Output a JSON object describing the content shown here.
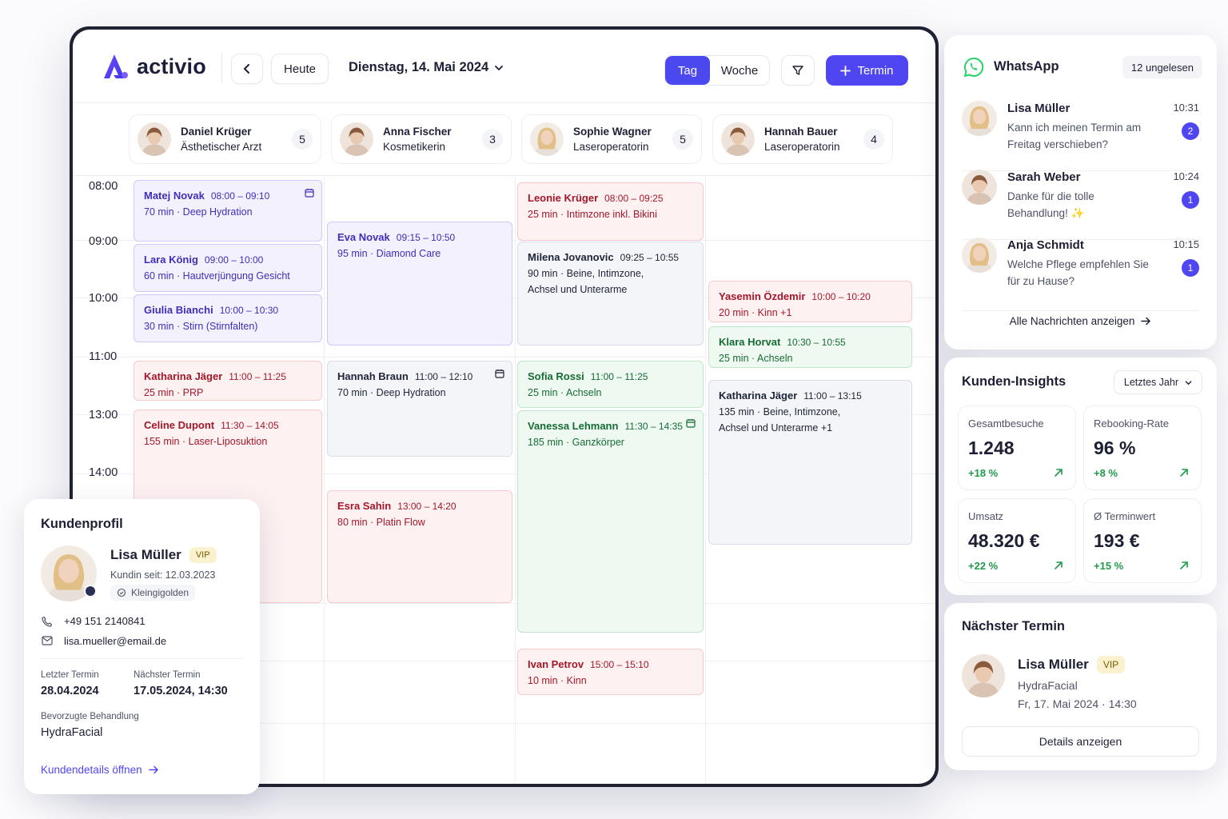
{
  "app": {
    "brand": "activio"
  },
  "toolbar": {
    "today": "Heute",
    "date": "Dienstag, 14. Mai 2024",
    "view_day": "Tag",
    "view_week": "Woche",
    "new_appointment": "Termin"
  },
  "staff": [
    {
      "name": "Daniel Krüger",
      "role": "Ästhetischer Arzt",
      "count": "5"
    },
    {
      "name": "Anna Fischer",
      "role": "Kosmetikerin",
      "count": "3"
    },
    {
      "name": "Sophie Wagner",
      "role": "Laseroperatorin",
      "count": "5"
    },
    {
      "name": "Hannah Bauer",
      "role": "Laseroperatorin",
      "count": "4"
    }
  ],
  "times": [
    "08:00",
    "09:00",
    "10:00",
    "11:00",
    "13:00",
    "14:00"
  ],
  "events": [
    {
      "name": "Matej Novak",
      "time": "08:00 – 09:10",
      "dur": "70 min",
      "treat": "Deep Hydration"
    },
    {
      "name": "Lara König",
      "time": "09:00 – 10:00",
      "dur": "60 min",
      "treat": "Hautverjüngung Gesicht"
    },
    {
      "name": "Giulia Bianchi",
      "time": "10:00 – 10:30",
      "dur": "30 min",
      "treat": "Stirn (Stirnfalten)"
    },
    {
      "name": "Katharina Jäger",
      "time": "11:00 – 11:25",
      "dur": "25 min",
      "treat": "PRP"
    },
    {
      "name": "Celine Dupont",
      "time": "11:30 – 14:05",
      "dur": "155 min",
      "treat": "Laser-Liposuktion"
    },
    {
      "name": "Eva Novak",
      "time": "09:15 – 10:50",
      "dur": "95 min",
      "treat": "Diamond Care"
    },
    {
      "name": "Hannah Braun",
      "time": "11:00 – 12:10",
      "dur": "70 min",
      "treat": "Deep Hydration"
    },
    {
      "name": "Esra Sahin",
      "time": "13:00 – 14:20",
      "dur": "80 min",
      "treat": "Platin Flow"
    },
    {
      "name": "Leonie Krüger",
      "time": "08:00 – 09:25",
      "dur": "25 min",
      "treat": "Intimzone inkl. Bikini"
    },
    {
      "name": "Milena Jovanovic",
      "time": "09:25 – 10:55",
      "dur": "90 min",
      "treat": "Beine, Intimzone,",
      "treat2": "Achsel und Unterarme"
    },
    {
      "name": "Sofia Rossi",
      "time": "11:00 – 11:25",
      "dur": "25 min",
      "treat": "Achseln"
    },
    {
      "name": "Vanessa Lehmann",
      "time": "11:30 – 14:35",
      "dur": "185 min",
      "treat": "Ganzkörper"
    },
    {
      "name": "Ivan Petrov",
      "time": "15:00 – 15:10",
      "dur": "10 min",
      "treat": "Kinn"
    },
    {
      "name": "Yasemin Özdemir",
      "time": "10:00 – 10:20",
      "dur": "20 min",
      "treat": "Kinn +1"
    },
    {
      "name": "Klara Horvat",
      "time": "10:30 – 10:55",
      "dur": "25 min",
      "treat": "Achseln"
    },
    {
      "name": "Katharina Jäger",
      "time": "11:00 – 13:15",
      "dur": "135 min",
      "treat": "Beine, Intimzone,",
      "treat2": "Achsel und Unterarme +1"
    }
  ],
  "sep": "·",
  "whatsapp": {
    "title": "WhatsApp",
    "unread": "12 ungelesen",
    "messages": [
      {
        "name": "Lisa Müller",
        "time": "10:31",
        "text": "Kann ich meinen Termin am Freitag verschieben?",
        "count": "2"
      },
      {
        "name": "Sarah Weber",
        "time": "10:24",
        "text": "Danke für die tolle Behandlung! ✨",
        "count": "1"
      },
      {
        "name": "Anja Schmidt",
        "time": "10:15",
        "text": "Welche Pflege empfehlen Sie für zu Hause?",
        "count": "1"
      }
    ],
    "all_link": "Alle Nachrichten anzeigen"
  },
  "insights": {
    "title": "Kunden-Insights",
    "period": "Letztes Jahr",
    "kpis": [
      {
        "label": "Gesamtbesuche",
        "value": "1.248",
        "delta": "+18 %"
      },
      {
        "label": "Rebooking-Rate",
        "value": "96 %",
        "delta": "+8 %"
      },
      {
        "label": "Umsatz",
        "value": "48.320 €",
        "delta": "+22 %"
      },
      {
        "label": "Ø Terminwert",
        "value": "193 €",
        "delta": "+15 %"
      }
    ]
  },
  "next": {
    "title": "Nächster Termin",
    "name": "Lisa Müller",
    "vip": "VIP",
    "treatment": "HydraFacial",
    "when": "Fr, 17. Mai 2024 · 14:30",
    "details": "Details anzeigen"
  },
  "profile": {
    "title": "Kundenprofil",
    "name": "Lisa Müller",
    "vip": "VIP",
    "since": "Kundin seit: 12.03.2023",
    "tier": "Kleingigolden",
    "phone": "+49 151 2140841",
    "email": "lisa.mueller@email.de",
    "last_label": "Letzter Termin",
    "last": "28.04.2024",
    "next_label": "Nächster Termin",
    "next": "17.05.2024, 14:30",
    "pref_label": "Bevorzugte Behandlung",
    "pref": "HydraFacial",
    "open_link": "Kundendetails öffnen"
  },
  "colors": {
    "accent": "#4f46f2",
    "purple": "#f3f1fe",
    "red": "#fef1f1",
    "green": "#eefaf1",
    "gray": "#f3f5f9",
    "positive": "#1f9a4a",
    "whatsapp": "#25d366"
  }
}
